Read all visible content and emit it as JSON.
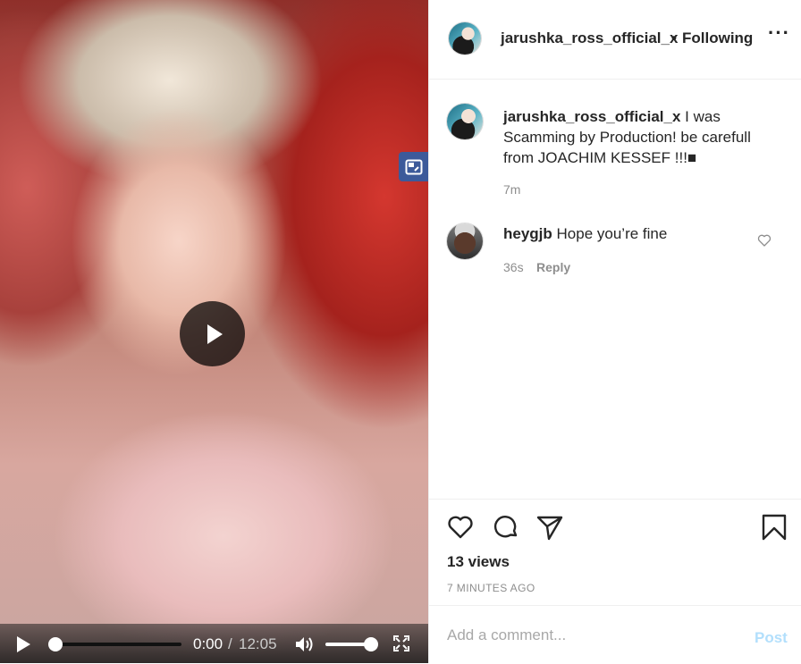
{
  "video": {
    "time_current": "0:00",
    "time_separator": "/",
    "time_duration": "12:05",
    "progress": 0,
    "volume": 1.0,
    "playing": false
  },
  "header": {
    "username": "jarushka_ross_official_x",
    "dot": "•",
    "follow_status": "Following",
    "more_label": "···"
  },
  "caption": {
    "username": "jarushka_ross_official_x",
    "text": " I was Scamming by Production! be carefull from JOACHIM KESSEF !!!■",
    "time": "7m"
  },
  "comments": [
    {
      "username": "heygjb",
      "text": " Hope you’re fine",
      "time": "36s",
      "reply_label": "Reply"
    }
  ],
  "actions": {
    "icons": [
      "heart-icon",
      "comment-icon",
      "share-icon",
      "bookmark-icon"
    ],
    "views": "13 views",
    "timestamp": "7 MINUTES AGO"
  },
  "comment_box": {
    "placeholder": "Add a comment...",
    "value": "",
    "post_label": "Post"
  },
  "colors": {
    "text": "#262626",
    "muted": "#8e8e8e",
    "post_disabled": "#b2dffc",
    "pip_badge": "#3c5a9a"
  }
}
